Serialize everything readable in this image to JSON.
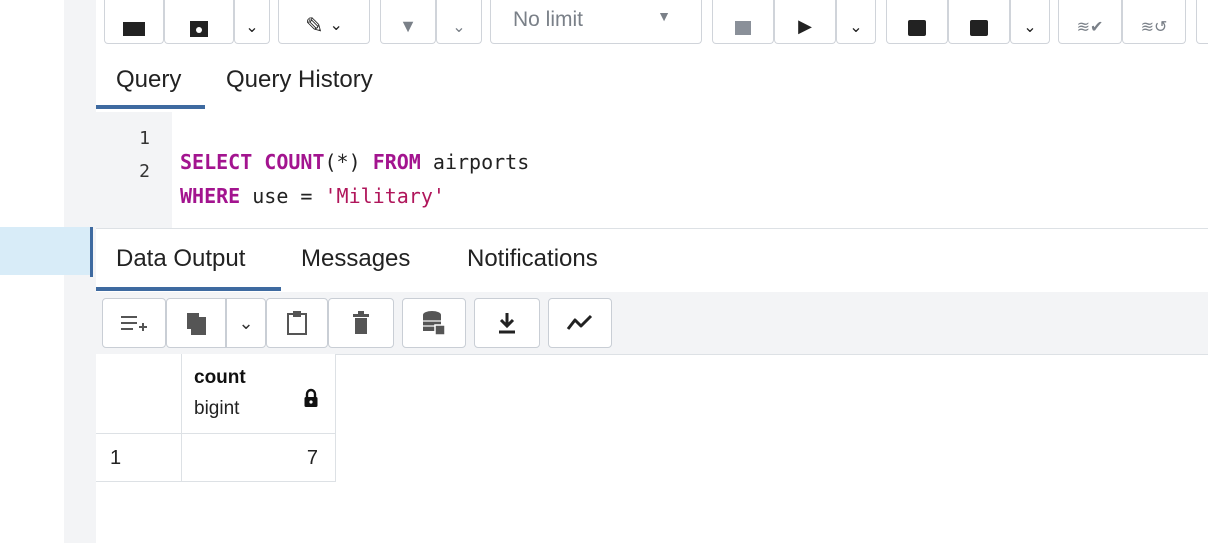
{
  "toolbar": {
    "limit_label": "No limit"
  },
  "query_tabs": [
    {
      "label": "Query"
    },
    {
      "label": "Query History"
    }
  ],
  "editor": {
    "lines": [
      {
        "number": "1",
        "tokens": [
          "SELECT",
          "COUNT",
          "(*)",
          "FROM",
          "airports"
        ]
      },
      {
        "number": "2",
        "tokens": [
          "WHERE",
          "use = ",
          "'Military'"
        ]
      }
    ]
  },
  "output_tabs": [
    {
      "label": "Data Output"
    },
    {
      "label": "Messages"
    },
    {
      "label": "Notifications"
    }
  ],
  "output_toolbar": {
    "icons": [
      "add-row-icon",
      "copy-icon",
      "chevron-down-icon",
      "paste-icon",
      "delete-icon",
      "save-data-icon",
      "download-icon",
      "graph-icon"
    ]
  },
  "grid": {
    "columns": [
      {
        "name": "count",
        "type": "bigint"
      }
    ],
    "rows": [
      {
        "row_number": "1",
        "values": [
          "7"
        ]
      }
    ]
  },
  "colors": {
    "accent": "#3e6aa0",
    "keyword": "#a3148f",
    "string": "#b0165b"
  }
}
